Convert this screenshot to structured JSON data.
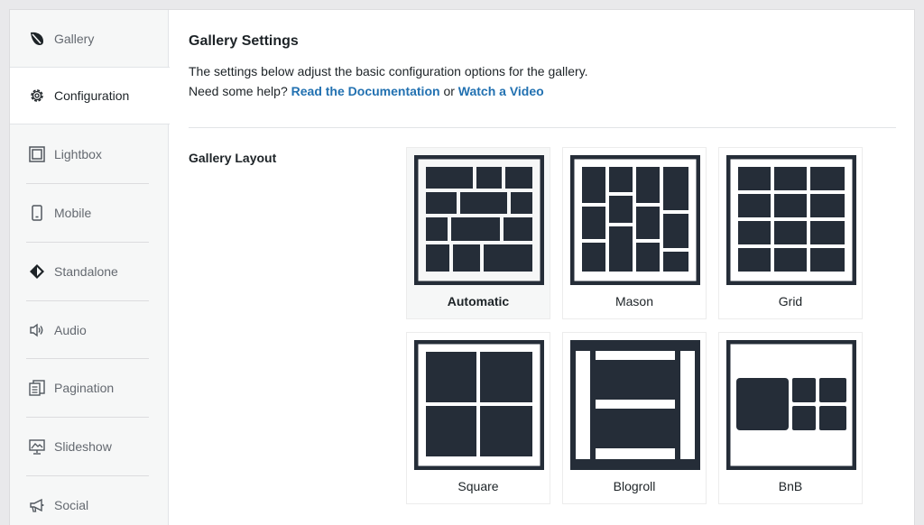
{
  "sidebar": {
    "items": [
      {
        "label": "Gallery",
        "icon": "leaf-icon"
      },
      {
        "label": "Configuration",
        "icon": "gear-icon",
        "active": true
      },
      {
        "label": "Lightbox",
        "icon": "lightbox-icon"
      },
      {
        "label": "Mobile",
        "icon": "mobile-icon"
      },
      {
        "label": "Standalone",
        "icon": "standalone-icon"
      },
      {
        "label": "Audio",
        "icon": "speaker-icon"
      },
      {
        "label": "Pagination",
        "icon": "pagination-icon"
      },
      {
        "label": "Slideshow",
        "icon": "slideshow-icon"
      },
      {
        "label": "Social",
        "icon": "megaphone-icon"
      }
    ]
  },
  "main": {
    "title": "Gallery Settings",
    "description": "The settings below adjust the basic configuration options for the gallery.",
    "help_prefix": "Need some help?",
    "doc_link": "Read the Documentation",
    "or_text": "or",
    "video_link": "Watch a Video",
    "layout_label": "Gallery Layout",
    "layouts": [
      {
        "label": "Automatic",
        "selected": true
      },
      {
        "label": "Mason"
      },
      {
        "label": "Grid"
      },
      {
        "label": "Square"
      },
      {
        "label": "Blogroll"
      },
      {
        "label": "BnB"
      }
    ]
  },
  "colors": {
    "accent": "#2271b1",
    "icon_dark": "#252d38"
  }
}
